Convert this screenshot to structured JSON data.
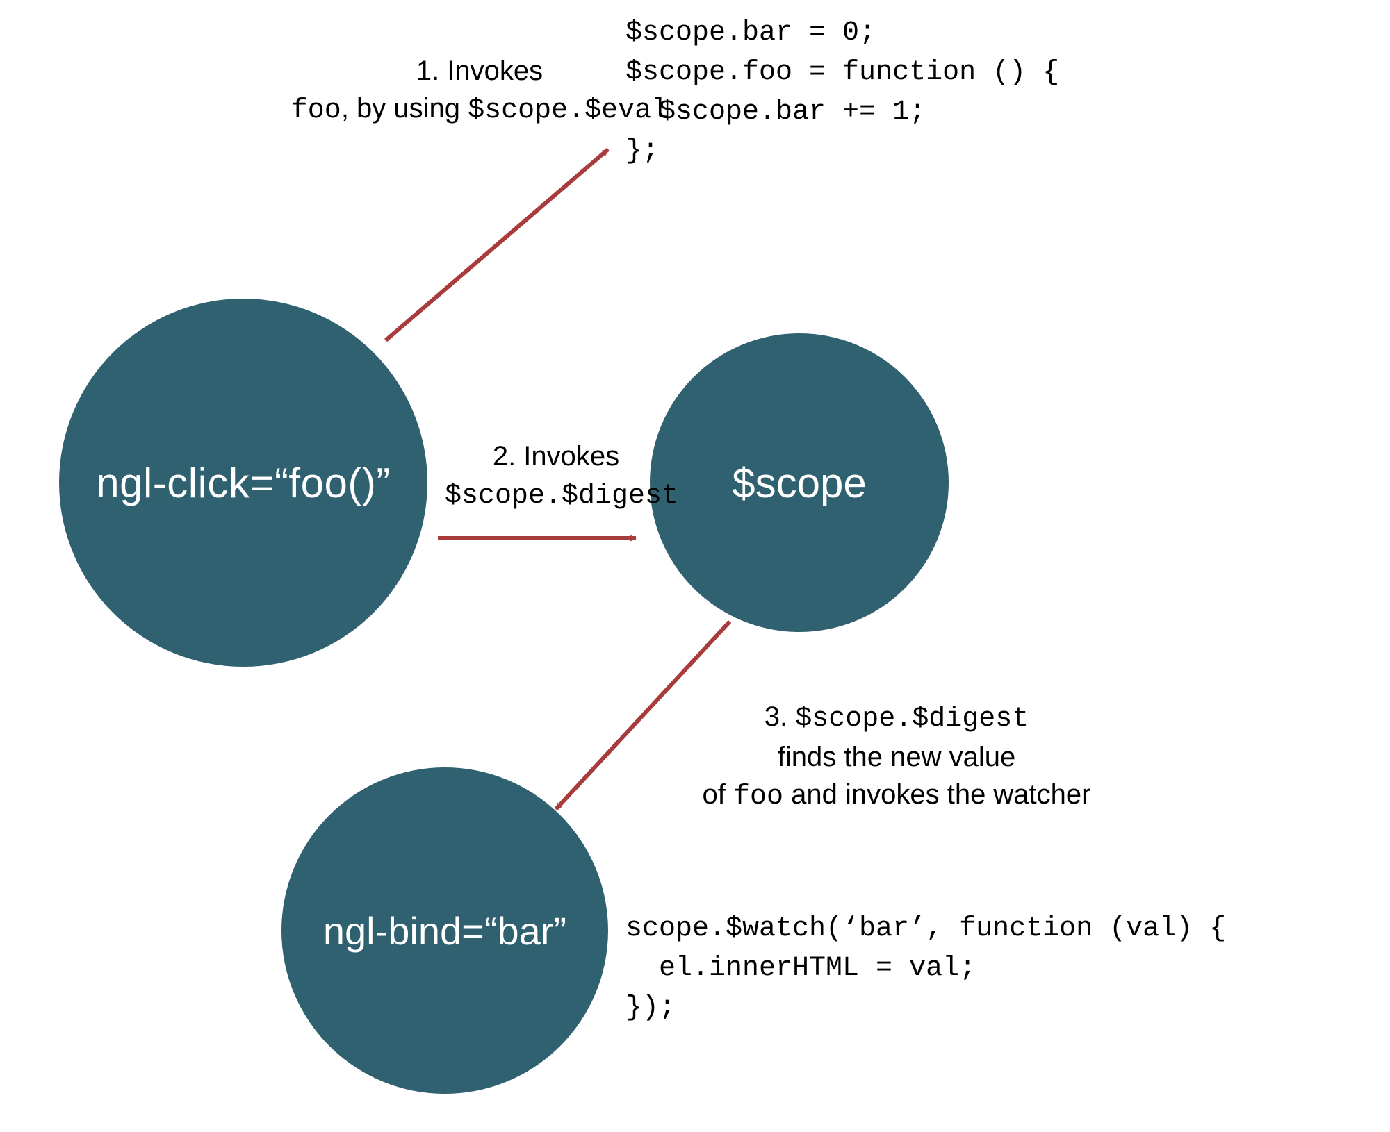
{
  "colors": {
    "node_fill": "#2f6171",
    "arrow": "#a83c3c",
    "background": "#ffffff",
    "text": "#000000",
    "node_text": "#ffffff"
  },
  "nodes": {
    "click": {
      "label": "ngl-click=“foo()”"
    },
    "scope": {
      "label": "$scope"
    },
    "bind": {
      "label": "ngl-bind=“bar”"
    }
  },
  "labels": {
    "step1_line1": "1. Invokes",
    "step1_line2_pre": "foo",
    "step1_line2_mid": ", by using ",
    "step1_line2_post": "$scope.$eval",
    "step2_line1": "2. Invokes",
    "step2_line2": "$scope.$digest",
    "step3_line1_pre": "3. ",
    "step3_line1_post": "$scope.$digest",
    "step3_line2": "finds the new value",
    "step3_line3_pre": "of ",
    "step3_line3_mid": "foo",
    "step3_line3_post": " and invokes the watcher"
  },
  "code": {
    "top": "$scope.bar = 0;\n$scope.foo = function () {\n  $scope.bar += 1;\n};",
    "bottom": "scope.$watch(‘bar’, function (val) {\n  el.innerHTML = val;\n});"
  }
}
